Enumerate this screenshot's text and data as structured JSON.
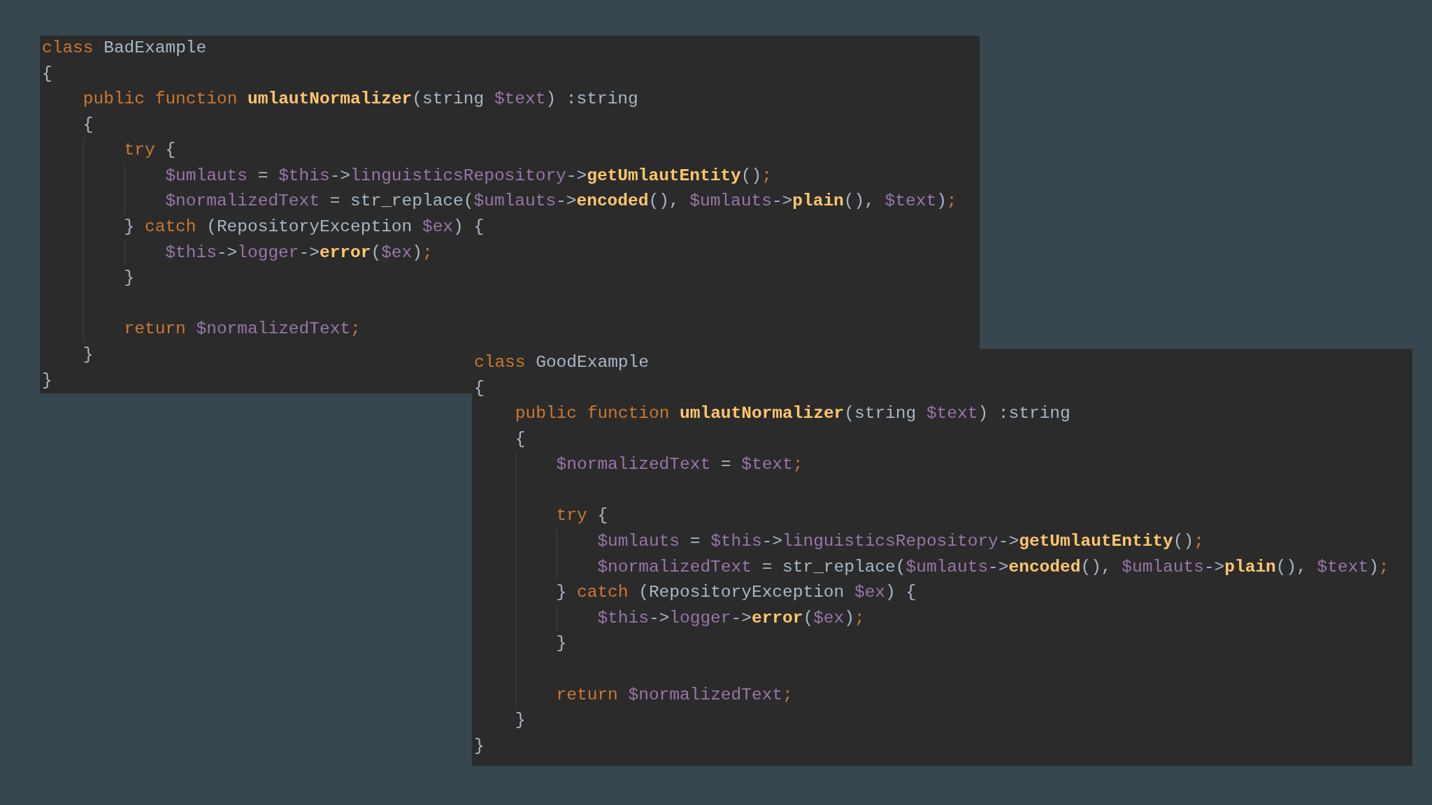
{
  "panels": [
    {
      "lines": [
        {
          "kind": "code",
          "tokens": [
            {
              "kind": "keyword",
              "text": "class"
            },
            {
              "kind": "plain",
              "text": " BadExample"
            }
          ]
        },
        {
          "kind": "code",
          "tokens": [
            {
              "kind": "plain",
              "text": "{"
            }
          ]
        },
        {
          "kind": "code",
          "tokens": [
            {
              "kind": "keyword",
              "text": "    public function "
            },
            {
              "kind": "function",
              "text": "umlautNormalizer"
            },
            {
              "kind": "plain",
              "text": "(string "
            },
            {
              "kind": "variable",
              "text": "$text"
            },
            {
              "kind": "plain",
              "text": ") :string"
            }
          ]
        },
        {
          "kind": "code",
          "tokens": [
            {
              "kind": "plain",
              "text": "    {"
            }
          ]
        },
        {
          "kind": "code",
          "tokens": [
            {
              "kind": "keyword",
              "text": "        try"
            },
            {
              "kind": "plain",
              "text": " {"
            }
          ]
        },
        {
          "kind": "code",
          "tokens": [
            {
              "kind": "variable",
              "text": "            $umlauts"
            },
            {
              "kind": "plain",
              "text": " = "
            },
            {
              "kind": "variable",
              "text": "$this"
            },
            {
              "kind": "plain",
              "text": "->"
            },
            {
              "kind": "variable",
              "text": "linguisticsRepository"
            },
            {
              "kind": "plain",
              "text": "->"
            },
            {
              "kind": "function",
              "text": "getUmlautEntity"
            },
            {
              "kind": "plain",
              "text": "()"
            },
            {
              "kind": "punct",
              "text": ";"
            }
          ]
        },
        {
          "kind": "code",
          "tokens": [
            {
              "kind": "variable",
              "text": "            $normalizedText"
            },
            {
              "kind": "plain",
              "text": " = str_replace("
            },
            {
              "kind": "variable",
              "text": "$umlauts"
            },
            {
              "kind": "plain",
              "text": "->"
            },
            {
              "kind": "function",
              "text": "encoded"
            },
            {
              "kind": "plain",
              "text": "(), "
            },
            {
              "kind": "variable",
              "text": "$umlauts"
            },
            {
              "kind": "plain",
              "text": "->"
            },
            {
              "kind": "function",
              "text": "plain"
            },
            {
              "kind": "plain",
              "text": "(), "
            },
            {
              "kind": "variable",
              "text": "$text"
            },
            {
              "kind": "plain",
              "text": ")"
            },
            {
              "kind": "punct",
              "text": ";"
            }
          ]
        },
        {
          "kind": "code",
          "tokens": [
            {
              "kind": "plain",
              "text": "        } "
            },
            {
              "kind": "keyword",
              "text": "catch"
            },
            {
              "kind": "plain",
              "text": " (RepositoryException "
            },
            {
              "kind": "variable",
              "text": "$ex"
            },
            {
              "kind": "plain",
              "text": ") {"
            }
          ]
        },
        {
          "kind": "code",
          "tokens": [
            {
              "kind": "variable",
              "text": "            $this"
            },
            {
              "kind": "plain",
              "text": "->"
            },
            {
              "kind": "variable",
              "text": "logger"
            },
            {
              "kind": "plain",
              "text": "->"
            },
            {
              "kind": "function",
              "text": "error"
            },
            {
              "kind": "plain",
              "text": "("
            },
            {
              "kind": "variable",
              "text": "$ex"
            },
            {
              "kind": "plain",
              "text": ")"
            },
            {
              "kind": "punct",
              "text": ";"
            }
          ]
        },
        {
          "kind": "code",
          "tokens": [
            {
              "kind": "plain",
              "text": "        }"
            }
          ]
        },
        {
          "kind": "blank"
        },
        {
          "kind": "code",
          "tokens": [
            {
              "kind": "keyword",
              "text": "        return "
            },
            {
              "kind": "variable",
              "text": "$normalizedText"
            },
            {
              "kind": "punct",
              "text": ";"
            }
          ]
        },
        {
          "kind": "code",
          "tokens": [
            {
              "kind": "plain",
              "text": "    }"
            }
          ]
        },
        {
          "kind": "code",
          "tokens": [
            {
              "kind": "plain",
              "text": "}"
            }
          ]
        }
      ]
    },
    {
      "lines": [
        {
          "kind": "code",
          "tokens": [
            {
              "kind": "keyword",
              "text": "class"
            },
            {
              "kind": "plain",
              "text": " GoodExample"
            }
          ]
        },
        {
          "kind": "code",
          "tokens": [
            {
              "kind": "plain",
              "text": "{"
            }
          ]
        },
        {
          "kind": "code",
          "tokens": [
            {
              "kind": "keyword",
              "text": "    public function "
            },
            {
              "kind": "function",
              "text": "umlautNormalizer"
            },
            {
              "kind": "plain",
              "text": "(string "
            },
            {
              "kind": "variable",
              "text": "$text"
            },
            {
              "kind": "plain",
              "text": ") :string"
            }
          ]
        },
        {
          "kind": "code",
          "tokens": [
            {
              "kind": "plain",
              "text": "    {"
            }
          ]
        },
        {
          "kind": "code",
          "tokens": [
            {
              "kind": "variable",
              "text": "        $normalizedText"
            },
            {
              "kind": "plain",
              "text": " = "
            },
            {
              "kind": "variable",
              "text": "$text"
            },
            {
              "kind": "punct",
              "text": ";"
            }
          ]
        },
        {
          "kind": "blank"
        },
        {
          "kind": "code",
          "tokens": [
            {
              "kind": "keyword",
              "text": "        try"
            },
            {
              "kind": "plain",
              "text": " {"
            }
          ]
        },
        {
          "kind": "code",
          "tokens": [
            {
              "kind": "variable",
              "text": "            $umlauts"
            },
            {
              "kind": "plain",
              "text": " = "
            },
            {
              "kind": "variable",
              "text": "$this"
            },
            {
              "kind": "plain",
              "text": "->"
            },
            {
              "kind": "variable",
              "text": "linguisticsRepository"
            },
            {
              "kind": "plain",
              "text": "->"
            },
            {
              "kind": "function",
              "text": "getUmlautEntity"
            },
            {
              "kind": "plain",
              "text": "()"
            },
            {
              "kind": "punct",
              "text": ";"
            }
          ]
        },
        {
          "kind": "code",
          "tokens": [
            {
              "kind": "variable",
              "text": "            $normalizedText"
            },
            {
              "kind": "plain",
              "text": " = str_replace("
            },
            {
              "kind": "variable",
              "text": "$umlauts"
            },
            {
              "kind": "plain",
              "text": "->"
            },
            {
              "kind": "function",
              "text": "encoded"
            },
            {
              "kind": "plain",
              "text": "(), "
            },
            {
              "kind": "variable",
              "text": "$umlauts"
            },
            {
              "kind": "plain",
              "text": "->"
            },
            {
              "kind": "function",
              "text": "plain"
            },
            {
              "kind": "plain",
              "text": "(), "
            },
            {
              "kind": "variable",
              "text": "$text"
            },
            {
              "kind": "plain",
              "text": ")"
            },
            {
              "kind": "punct",
              "text": ";"
            }
          ]
        },
        {
          "kind": "code",
          "tokens": [
            {
              "kind": "plain",
              "text": "        } "
            },
            {
              "kind": "keyword",
              "text": "catch"
            },
            {
              "kind": "plain",
              "text": " (RepositoryException "
            },
            {
              "kind": "variable",
              "text": "$ex"
            },
            {
              "kind": "plain",
              "text": ") {"
            }
          ]
        },
        {
          "kind": "code",
          "tokens": [
            {
              "kind": "variable",
              "text": "            $this"
            },
            {
              "kind": "plain",
              "text": "->"
            },
            {
              "kind": "variable",
              "text": "logger"
            },
            {
              "kind": "plain",
              "text": "->"
            },
            {
              "kind": "function",
              "text": "error"
            },
            {
              "kind": "plain",
              "text": "("
            },
            {
              "kind": "variable",
              "text": "$ex"
            },
            {
              "kind": "plain",
              "text": ")"
            },
            {
              "kind": "punct",
              "text": ";"
            }
          ]
        },
        {
          "kind": "code",
          "tokens": [
            {
              "kind": "plain",
              "text": "        }"
            }
          ]
        },
        {
          "kind": "blank"
        },
        {
          "kind": "code",
          "tokens": [
            {
              "kind": "keyword",
              "text": "        return "
            },
            {
              "kind": "variable",
              "text": "$normalizedText"
            },
            {
              "kind": "punct",
              "text": ";"
            }
          ]
        },
        {
          "kind": "code",
          "tokens": [
            {
              "kind": "plain",
              "text": "    }"
            }
          ]
        },
        {
          "kind": "code",
          "tokens": [
            {
              "kind": "plain",
              "text": "}"
            }
          ]
        }
      ]
    }
  ]
}
